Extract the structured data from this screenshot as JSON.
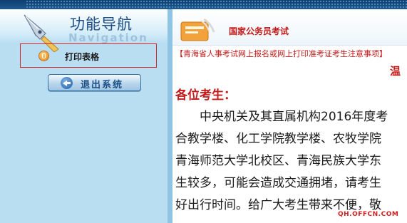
{
  "sidebar": {
    "title": "功能导航",
    "subtitle": "Navigation",
    "menu_item": {
      "label": "打印表格",
      "icon": "document-icon"
    },
    "logout_label": "退出系统"
  },
  "content": {
    "section_title": "国家公务员考试",
    "notice_title": "【青海省人事考试网上报名或网上打印准考证考生注意事项】",
    "greeting_fragment": "温",
    "salutation": "各位考生：",
    "paragraph_lines": [
      "　　中央机关及其直属机构2016年度考",
      "合教学楼、化工学院教学楼、农牧学院",
      "青海师范大学北校区、青海民族大学东",
      "生较多，可能会造成交通拥堵，请考生",
      "好出行时间。给广大考生带来不便，敬"
    ]
  },
  "watermark": "QH.OFFCN.COM",
  "colors": {
    "accent_red": "#c41a1a",
    "sidebar_bg": "#b9def2",
    "highlight_border": "#d8222a",
    "nav_blue": "#1d4f86"
  }
}
